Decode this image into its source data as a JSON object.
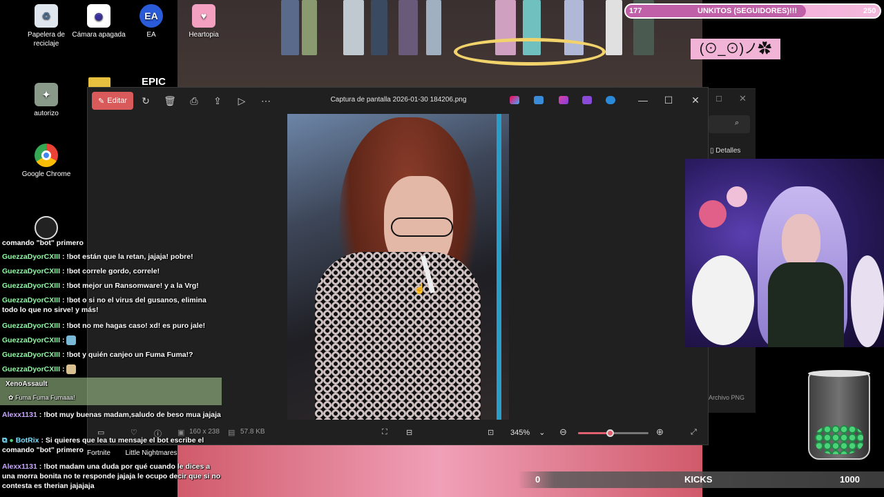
{
  "desktop": {
    "icons": [
      {
        "label": "Papelera de reciclaje",
        "icon": "recycle-bin-icon"
      },
      {
        "label": "Cámara apagada",
        "icon": "camera-icon"
      },
      {
        "label": "EA",
        "icon": "ea-icon"
      },
      {
        "label": "Heartopia",
        "icon": "heartopia-icon"
      },
      {
        "label": "autorizo",
        "icon": "app-icon"
      },
      {
        "label": "Google Chrome",
        "icon": "chrome-icon"
      },
      {
        "label": "Fortnite",
        "icon": "fortnite-icon"
      },
      {
        "label": "Little Nightmares",
        "icon": "little-nightmares-icon"
      }
    ],
    "epic_label": "EPIC"
  },
  "viewer": {
    "edit_label": "Editar",
    "title": "Captura de pantalla 2026-01-30 184206.png",
    "dimensions": "160 x 238",
    "file_size": "57.8 KB",
    "zoom": "345%",
    "zoom_fraction": 0.45
  },
  "explorer": {
    "details_label": "Detalles",
    "file_type": "Archivo PNG"
  },
  "overlay": {
    "followers_current": "177",
    "followers_title": "UNKITOS (SEGUIDORES)!!!",
    "followers_goal": "250",
    "followers_fraction": 0.71,
    "kaomoji": "(⊙_⊙)ノ✿",
    "kicks_current": "0",
    "kicks_label": "KICKS",
    "kicks_goal": "1000"
  },
  "chat": {
    "lines": [
      {
        "user": "",
        "text": "comando \"bot\" primero"
      },
      {
        "user": "GuezzaDyorCXIII",
        "text": " : !bot están que la retan, jajaja! pobre!"
      },
      {
        "user": "GuezzaDyorCXIII",
        "text": " : !bot correle gordo, correle!"
      },
      {
        "user": "GuezzaDyorCXIII",
        "text": " : !bot mejor un Ransomware! y a la Vrg!"
      },
      {
        "user": "GuezzaDyorCXIII",
        "text": " : !bot o si no el virus del gusanos, elimina todo lo que no sirve! y más!"
      },
      {
        "user": "GuezzaDyorCXIII",
        "text": " : !bot no me hagas caso! xd! es puro jale!"
      },
      {
        "user": "GuezzaDyorCXIII",
        "text": " :"
      },
      {
        "user": "GuezzaDyorCXIII",
        "text": " : !bot y quién canjeo un Fuma Fuma!?"
      },
      {
        "user": "GuezzaDyorCXIII",
        "text": " :"
      },
      {
        "user": "Alexx1131",
        "text": " : !bot muy buenas madam,saludo de beso mua jajaja"
      },
      {
        "user": "BotRix",
        "text": " : Si quieres que lea tu mensaje el bot escribe el comando \"bot\" primero"
      },
      {
        "user": "Alexx1131",
        "text": " : !bot madam una duda por qué cuando le dices a una morra bonita no te responde jajaja le ocupo decir que si no contesta es therian jajajaja"
      }
    ],
    "redeem_user": "XenoAssault",
    "redeem_text": "Fuma Fuma Fumaaa!"
  }
}
